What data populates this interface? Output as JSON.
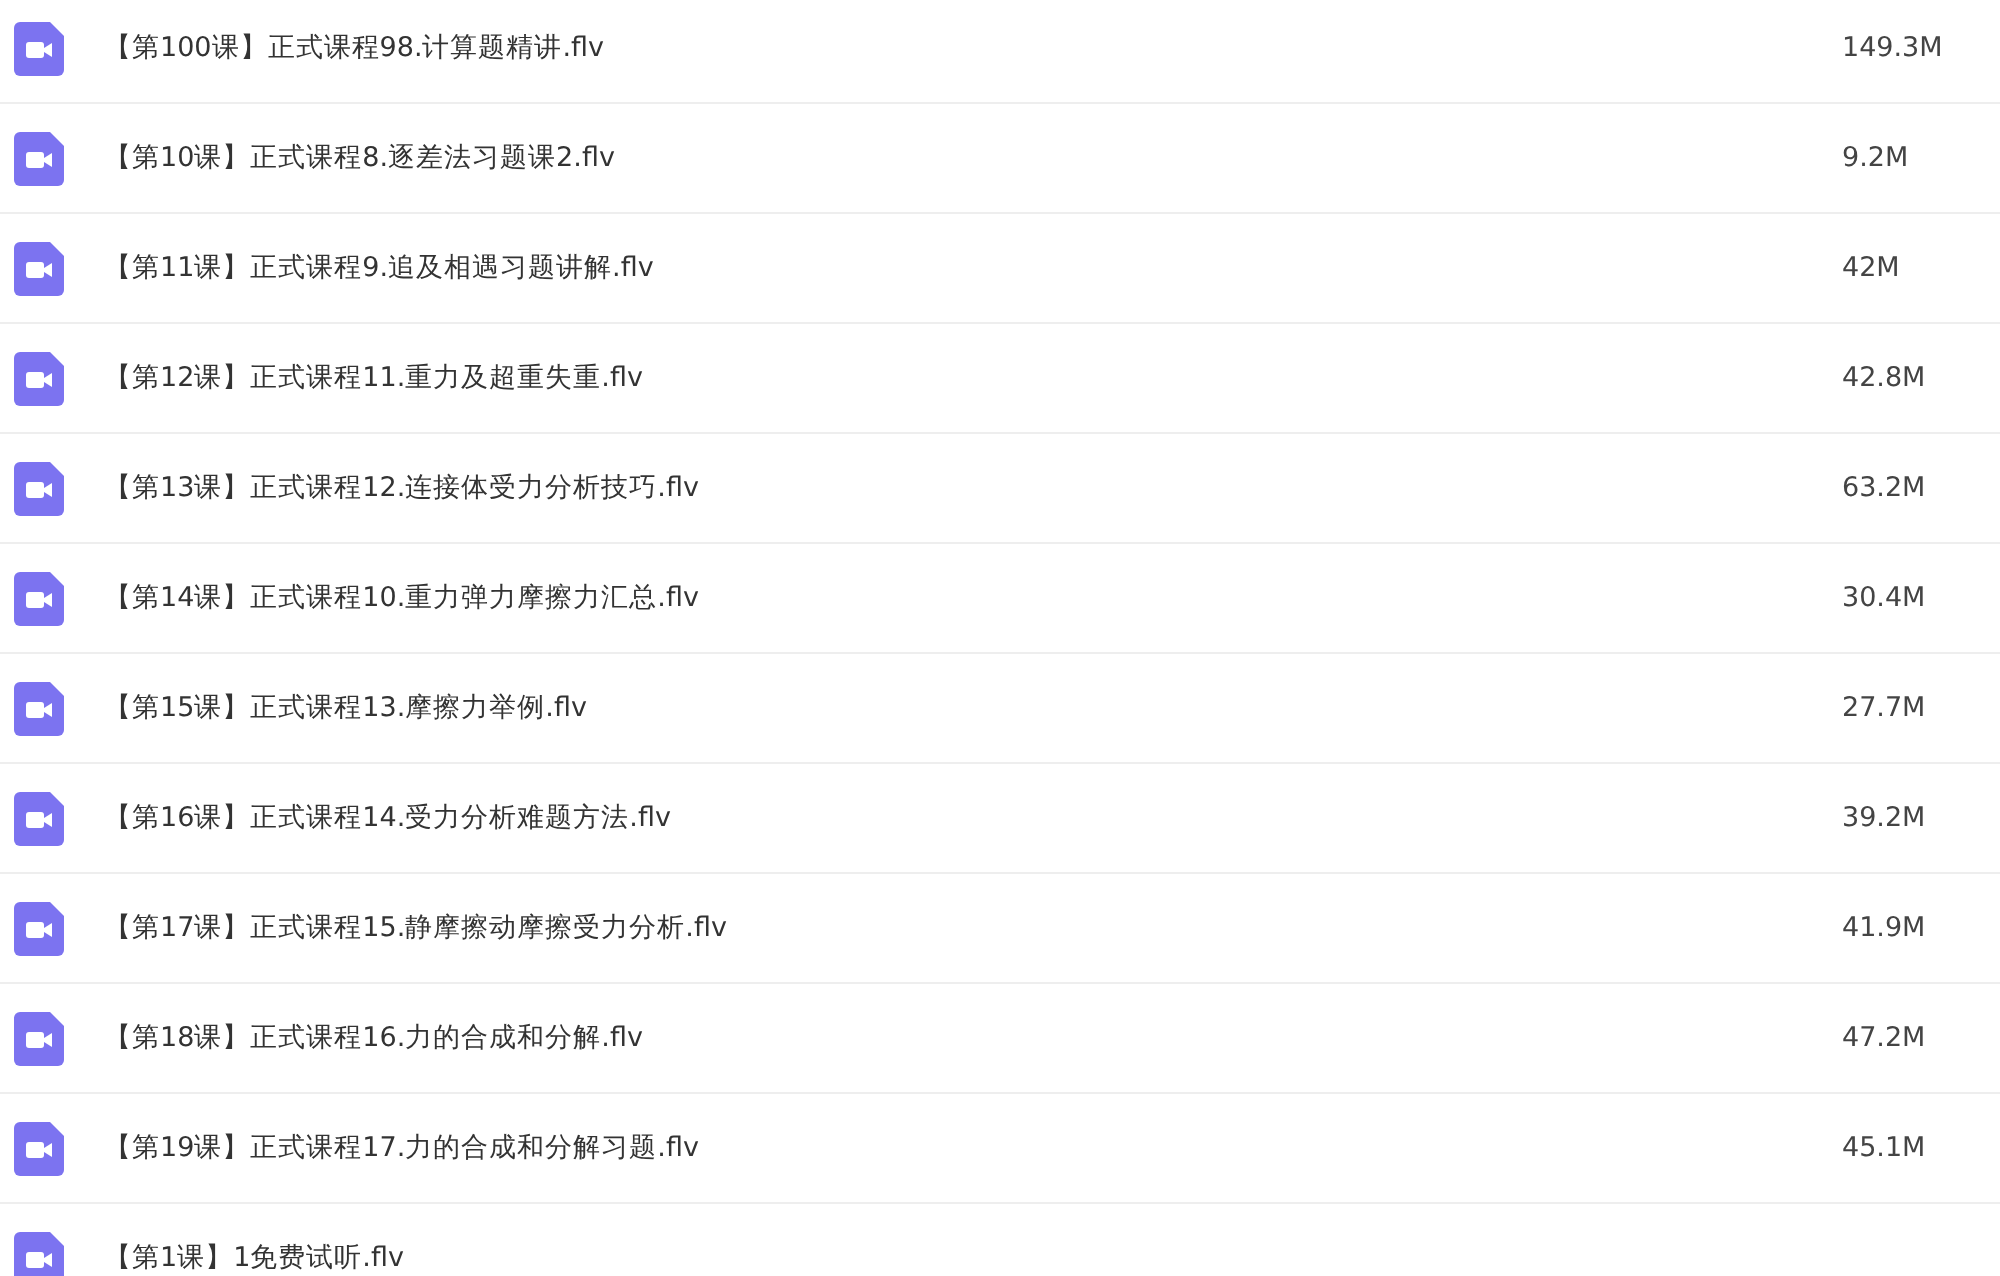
{
  "files": [
    {
      "name": "【第100课】正式课程98.计算题精讲.flv",
      "size": "149.3M"
    },
    {
      "name": "【第10课】正式课程8.逐差法习题课2.flv",
      "size": "9.2M"
    },
    {
      "name": "【第11课】正式课程9.追及相遇习题讲解.flv",
      "size": "42M"
    },
    {
      "name": "【第12课】正式课程11.重力及超重失重.flv",
      "size": "42.8M"
    },
    {
      "name": "【第13课】正式课程12.连接体受力分析技巧.flv",
      "size": "63.2M"
    },
    {
      "name": "【第14课】正式课程10.重力弹力摩擦力汇总.flv",
      "size": "30.4M"
    },
    {
      "name": "【第15课】正式课程13.摩擦力举例.flv",
      "size": "27.7M"
    },
    {
      "name": "【第16课】正式课程14.受力分析难题方法.flv",
      "size": "39.2M"
    },
    {
      "name": "【第17课】正式课程15.静摩擦动摩擦受力分析.flv",
      "size": "41.9M"
    },
    {
      "name": "【第18课】正式课程16.力的合成和分解.flv",
      "size": "47.2M"
    },
    {
      "name": "【第19课】正式课程17.力的合成和分解习题.flv",
      "size": "45.1M"
    },
    {
      "name": "【第1课】1免费试听.flv"
    }
  ]
}
